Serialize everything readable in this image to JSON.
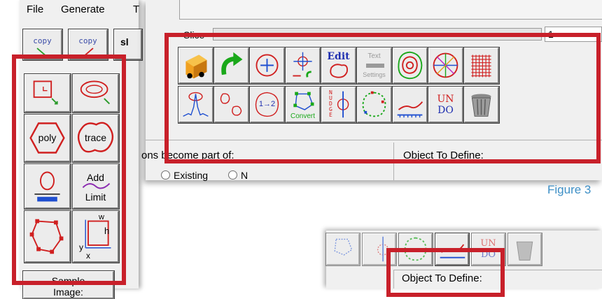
{
  "menu": {
    "file": "File",
    "generate": "Generate",
    "truncated": "T"
  },
  "left_panel": {
    "copy_buttons": [
      "copy",
      "copy",
      "sl"
    ],
    "tools": {
      "poly": "poly",
      "trace": "trace",
      "add_limit_line1": "Add",
      "add_limit_line2": "Limit",
      "corner_h": "h",
      "corner_w": "w",
      "corner_y": "y",
      "corner_x": "x"
    },
    "sample_image_line1": "Sample",
    "sample_image_line2": "Image:"
  },
  "main_panel": {
    "slice_label": "Slice",
    "slice_value": "1",
    "buttons_row1": [
      "move-section",
      "redo",
      "center-target",
      "scale-arrows",
      "edit",
      "text-settings",
      "concentric-trace",
      "color-wheel",
      "grid"
    ],
    "edit_label": "Edit",
    "text_settings_line1": "Text",
    "text_settings_line2": "Settings",
    "buttons_row2": [
      "trace-peak",
      "separate-traces",
      "number-traces",
      "convert",
      "nudge",
      "scatter-points",
      "graph-line",
      "undo",
      "trash"
    ],
    "number_label": "1→2",
    "convert_label": "Convert",
    "nudge_label": "NUDGE",
    "undo_line1": "UN",
    "undo_line2": "DO",
    "become_part_of": "ons become part of:",
    "existing": "Existing",
    "new_label": "N",
    "object_to_define": "Object To Define:"
  },
  "figure_label": "Figure 3",
  "zoom_panel": {
    "object_to_define": "Object To Define:",
    "undo_line1": "UN",
    "undo_line2": "DO"
  },
  "colors": {
    "highlight": "#c8202a",
    "figure_label": "#3d8fc6",
    "panel_bg": "#f0f0f0"
  }
}
